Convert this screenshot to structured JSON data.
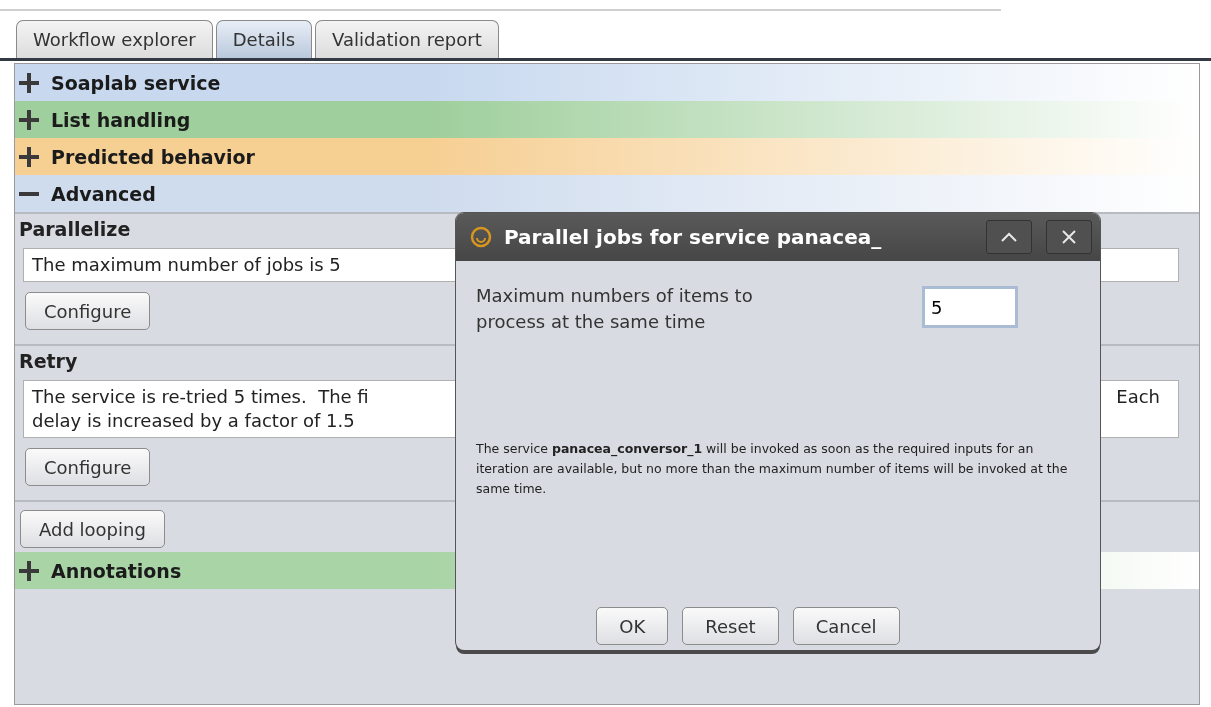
{
  "tabs": [
    {
      "label": "Workflow explorer",
      "selected": false
    },
    {
      "label": "Details",
      "selected": true
    },
    {
      "label": "Validation report",
      "selected": false
    }
  ],
  "sections": [
    {
      "title": "Soaplab service",
      "expanded": false,
      "color": "#c8d9ef"
    },
    {
      "title": "List handling",
      "expanded": false,
      "color": "#9fcf9c"
    },
    {
      "title": "Predicted behavior",
      "expanded": false,
      "color": "#f6cf93"
    },
    {
      "title": "Advanced",
      "expanded": true,
      "color": "#cfdcee",
      "groups": [
        {
          "title": "Parallelize",
          "lines": [
            {
              "left": "The maximum number of jobs is 5"
            }
          ],
          "button": "Configure"
        },
        {
          "title": "Retry",
          "lines": [
            {
              "left": "The service is re-tried 5 times.  The fi",
              "right": "Each"
            },
            {
              "left": "delay is increased by a factor of 1.5"
            }
          ],
          "button": "Configure"
        }
      ],
      "buttons": [
        "Add looping"
      ]
    },
    {
      "title": "Annotations",
      "expanded": false,
      "color": "#a9d4a6"
    }
  ],
  "dialog": {
    "title": "Parallel jobs for service panacea_",
    "field_label": "Maximum numbers of items to process at the same time",
    "field_value": "5",
    "description": "The service **panacea_conversor_1** will be invoked as soon as the required inputs for an iteration are available, but no more than the maximum number of items will be invoked at the same time.",
    "buttons": [
      "OK",
      "Reset",
      "Cancel"
    ]
  }
}
